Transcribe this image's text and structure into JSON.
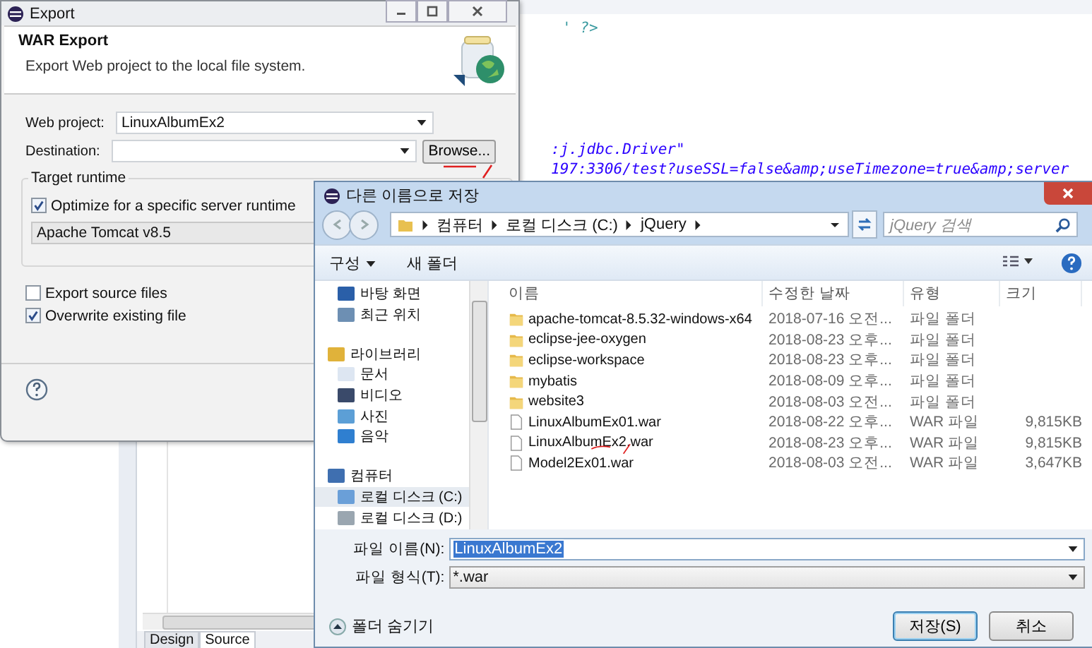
{
  "editor": {
    "code_lines": [
      {
        "text": "' ?>",
        "kind": "pi"
      },
      {
        "text": ":j.jdbc.Driver\"",
        "kind": "string"
      },
      {
        "text": "197:3306/test?useSSL=false&amp;useTimezone=true&amp;server",
        "kind": "string"
      }
    ],
    "tabs": [
      {
        "label": "Design",
        "selected": false
      },
      {
        "label": "Source",
        "selected": true
      }
    ]
  },
  "export_dialog": {
    "title": "Export",
    "heading": "WAR Export",
    "description": "Export Web project to the local file system.",
    "web_project": {
      "label": "Web project:",
      "value": "LinuxAlbumEx2"
    },
    "destination": {
      "label": "Destination:"
    },
    "browse_button": "Browse...",
    "target_runtime": {
      "title": "Target runtime",
      "optimize": {
        "label": "Optimize for a specific server runtime",
        "checked": true
      },
      "runtime": "Apache Tomcat v8.5"
    },
    "options": [
      {
        "label": "Export source files",
        "checked": false
      },
      {
        "label": "Overwrite existing file",
        "checked": true
      }
    ]
  },
  "save_dialog": {
    "title": "다른 이름으로 저장",
    "breadcrumb": [
      "컴퓨터",
      "로컬 디스크 (C:)",
      "jQuery"
    ],
    "search": {
      "placeholder": "jQuery 검색"
    },
    "toolbar": [
      {
        "label": "구성",
        "kind": "menu"
      },
      {
        "label": "새 폴더",
        "kind": "plain"
      }
    ],
    "nav": [
      {
        "label": "바탕 화면",
        "kind": "desktop",
        "selected": false
      },
      {
        "label": "최근 위치",
        "kind": "recent",
        "selected": false
      },
      {
        "label": "라이브러리",
        "kind": "library",
        "selected": false,
        "children": [
          {
            "label": "문서",
            "kind": "document",
            "selected": false
          },
          {
            "label": "비디오",
            "kind": "video",
            "selected": false
          },
          {
            "label": "사진",
            "kind": "picture",
            "selected": false
          },
          {
            "label": "음악",
            "kind": "music",
            "selected": false
          }
        ]
      },
      {
        "label": "컴퓨터",
        "kind": "computer",
        "selected": false,
        "children": [
          {
            "label": "로컬 디스크 (C:)",
            "kind": "system",
            "selected": true
          },
          {
            "label": "로컬 디스크 (D:)",
            "kind": "disk",
            "selected": false
          }
        ]
      }
    ],
    "columns": [
      "이름",
      "수정한 날짜",
      "유형",
      "크기"
    ],
    "files": [
      {
        "name": "apache-tomcat-8.5.32-windows-x64",
        "date": "2018-07-16 오전...",
        "type": "파일 폴더",
        "kind": "folder"
      },
      {
        "name": "eclipse-jee-oxygen",
        "date": "2018-08-23 오후...",
        "type": "파일 폴더",
        "kind": "folder"
      },
      {
        "name": "eclipse-workspace",
        "date": "2018-08-23 오후...",
        "type": "파일 폴더",
        "kind": "folder"
      },
      {
        "name": "mybatis",
        "date": "2018-08-09 오후...",
        "type": "파일 폴더",
        "kind": "folder"
      },
      {
        "name": "website3",
        "date": "2018-08-03 오전...",
        "type": "파일 폴더",
        "kind": "folder"
      },
      {
        "name": "LinuxAlbumEx01.war",
        "date": "2018-08-22 오후...",
        "type": "WAR 파일",
        "size": "9,815KB",
        "kind": "file"
      },
      {
        "name": "LinuxAlbumEx2.war",
        "date": "2018-08-23 오후...",
        "type": "WAR 파일",
        "size": "9,815KB",
        "kind": "file"
      },
      {
        "name": "Model2Ex01.war",
        "date": "2018-08-03 오전...",
        "type": "WAR 파일",
        "size": "3,647KB",
        "kind": "file"
      }
    ],
    "file_name": {
      "label": "파일 이름(N):",
      "value": "LinuxAlbumEx2"
    },
    "file_type": {
      "label": "파일 형식(T):",
      "value": "*.war"
    },
    "hide_folders": "폴더 숨기기",
    "buttons": [
      {
        "label": "저장(S)",
        "default": true
      },
      {
        "label": "취소",
        "default": false
      }
    ]
  }
}
